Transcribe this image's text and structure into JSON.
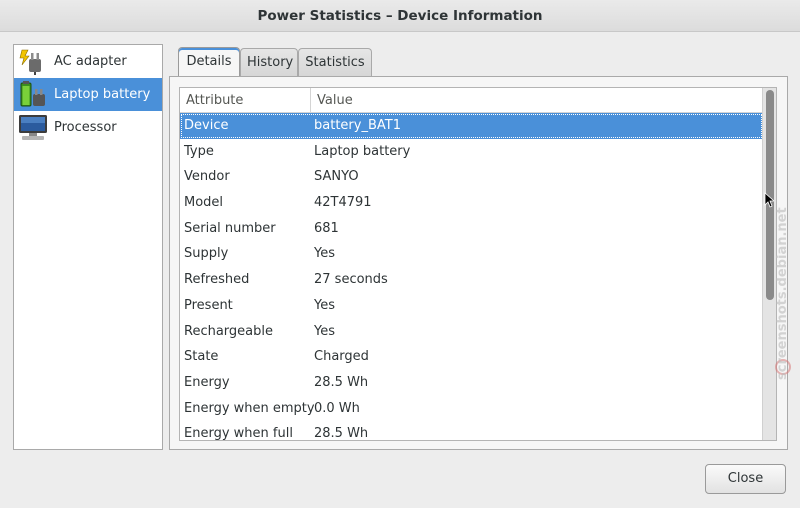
{
  "window": {
    "title": "Power Statistics – Device Information"
  },
  "devices": [
    {
      "label": "AC adapter",
      "icon": "ac-adapter-icon",
      "selected": false
    },
    {
      "label": "Laptop battery",
      "icon": "laptop-battery-icon",
      "selected": true
    },
    {
      "label": "Processor",
      "icon": "processor-icon",
      "selected": false
    }
  ],
  "tabs": [
    {
      "label": "Details",
      "active": true
    },
    {
      "label": "History",
      "active": false
    },
    {
      "label": "Statistics",
      "active": false
    }
  ],
  "table": {
    "columns": [
      "Attribute",
      "Value"
    ],
    "rows": [
      {
        "attribute": "Device",
        "value": "battery_BAT1",
        "selected": true
      },
      {
        "attribute": "Type",
        "value": "Laptop battery"
      },
      {
        "attribute": "Vendor",
        "value": "SANYO"
      },
      {
        "attribute": "Model",
        "value": "42T4791"
      },
      {
        "attribute": "Serial number",
        "value": "681"
      },
      {
        "attribute": "Supply",
        "value": "Yes"
      },
      {
        "attribute": "Refreshed",
        "value": "27 seconds"
      },
      {
        "attribute": "Present",
        "value": "Yes"
      },
      {
        "attribute": "Rechargeable",
        "value": "Yes"
      },
      {
        "attribute": "State",
        "value": "Charged"
      },
      {
        "attribute": "Energy",
        "value": "28.5 Wh"
      },
      {
        "attribute": "Energy when empty",
        "value": "0.0 Wh"
      },
      {
        "attribute": "Energy when full",
        "value": "28.5 Wh"
      }
    ]
  },
  "buttons": {
    "close_label": "Close"
  },
  "watermark": {
    "text": "screenshots.debian.net"
  },
  "colors": {
    "selection": "#4a90d9",
    "window_bg": "#ededed"
  }
}
